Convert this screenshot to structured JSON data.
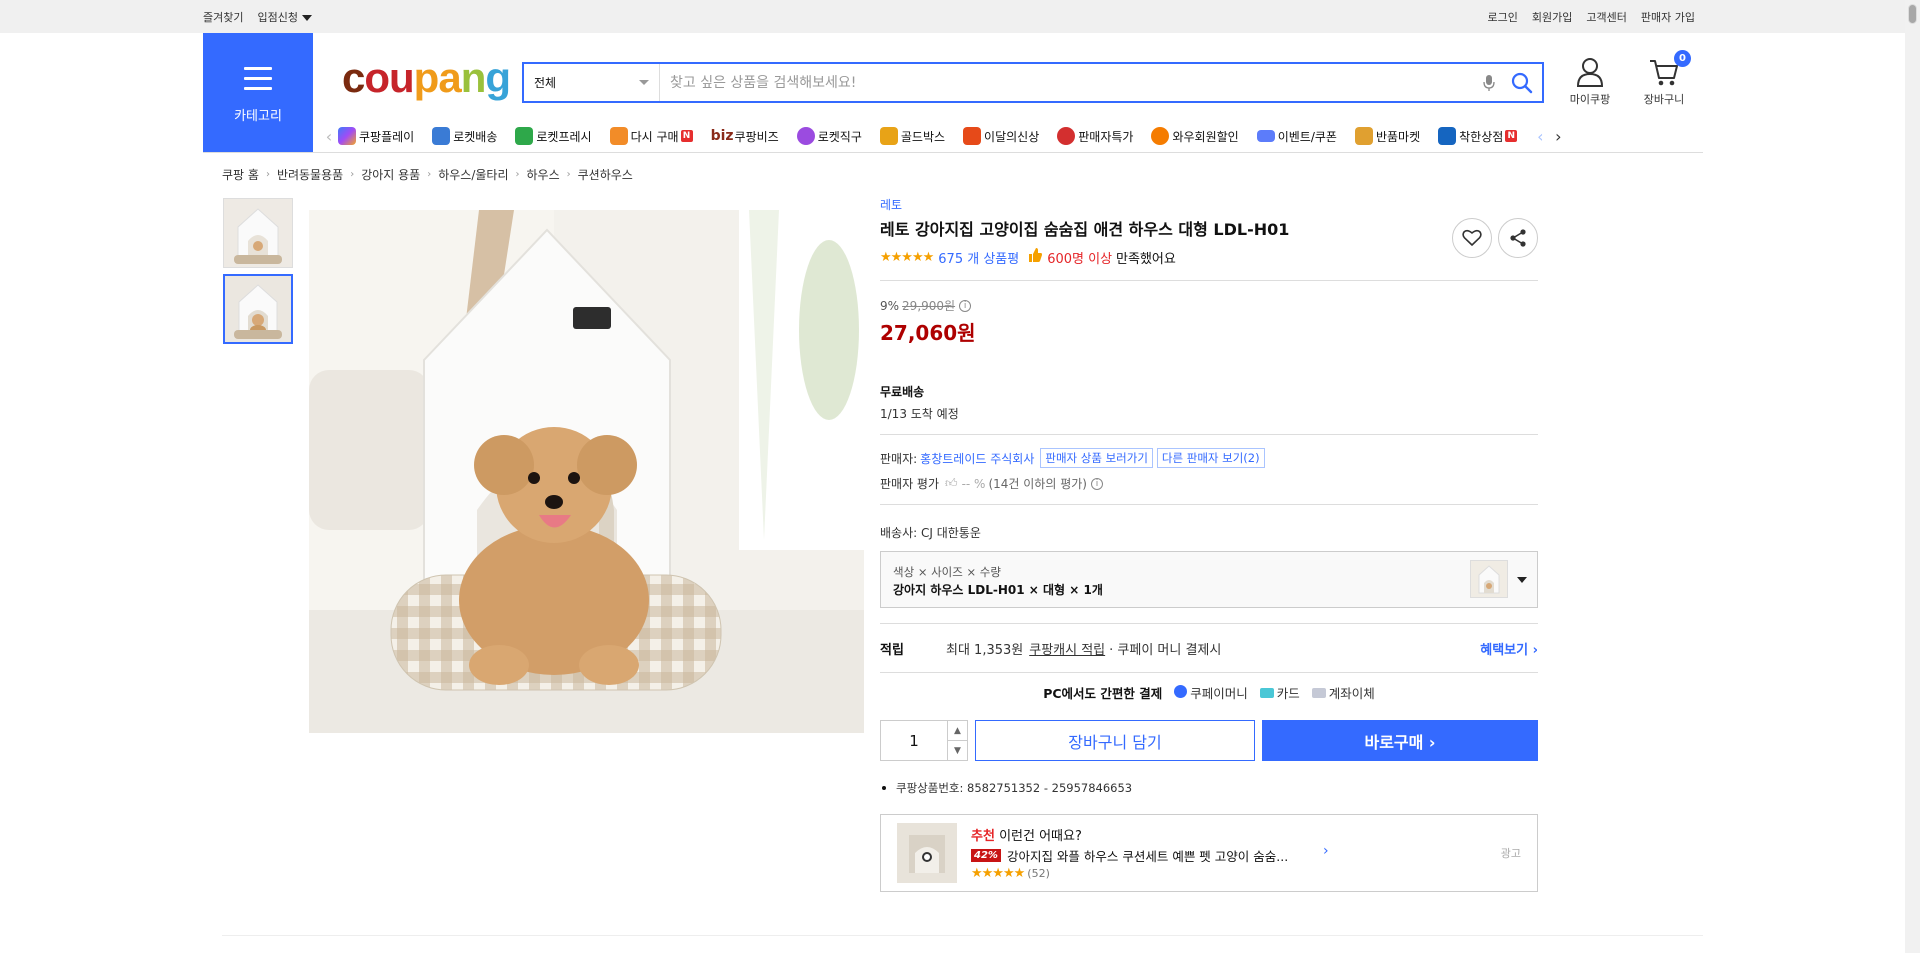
{
  "topbar": {
    "favorites": "즐겨찾기",
    "register": "입점신청",
    "links": [
      "로그인",
      "회원가입",
      "고객센터",
      "판매자 가입"
    ]
  },
  "category": {
    "label": "카테고리"
  },
  "logo": {
    "p1": "c",
    "p2": "ou",
    "p3": "pa",
    "p4": "n",
    "p5": "g"
  },
  "search": {
    "category": "전체",
    "placeholder": "찾고 싶은 상품을 검색해보세요!"
  },
  "account": {
    "my": "마이쿠팡",
    "cart": "장바구니",
    "cart_count": "0"
  },
  "nav": {
    "items": [
      {
        "label": "쿠팡플레이",
        "icon": "coupang-play-icon",
        "color": "#6b4ff0"
      },
      {
        "label": "로켓배송",
        "icon": "rocket-icon",
        "color": "#3a7bd5"
      },
      {
        "label": "로켓프레시",
        "icon": "rocket-fresh-icon",
        "color": "#2ea84a"
      },
      {
        "label": "다시 구매",
        "icon": "rebuy-icon",
        "color": "#f28c28",
        "badge": "N"
      },
      {
        "label": "쿠팡비즈",
        "icon": "biz-icon",
        "color": "#8a2b1a"
      },
      {
        "label": "로켓직구",
        "icon": "rocket-global-icon",
        "color": "#9b4be0"
      },
      {
        "label": "골드박스",
        "icon": "goldbox-icon",
        "color": "#e8a317"
      },
      {
        "label": "이달의신상",
        "icon": "new-icon",
        "color": "#e64a19"
      },
      {
        "label": "판매자특가",
        "icon": "seller-deal-icon",
        "color": "#d32f2f"
      },
      {
        "label": "와우회원할인",
        "icon": "wow-icon",
        "color": "#f57c00"
      },
      {
        "label": "이벤트/쿠폰",
        "icon": "coupon-icon",
        "color": "#5c7cfa"
      },
      {
        "label": "반품마켓",
        "icon": "return-market-icon",
        "color": "#e0a030"
      },
      {
        "label": "착한상점",
        "icon": "good-store-icon",
        "color": "#1565c0",
        "badge": "N"
      }
    ],
    "biz_prefix": "biz"
  },
  "breadcrumb": [
    "쿠팡 홈",
    "반려동물용품",
    "강아지 용품",
    "하우스/울타리",
    "하우스",
    "쿠션하우스"
  ],
  "product": {
    "brand": "레토",
    "title": "레토 강아지집 고양이집 숨숨집 애견 하우스 대형 LDL-H01",
    "stars": "★★★★★",
    "review_count": "675 개 상품평",
    "satisfied_count": "600명 이상",
    "satisfied_suffix": "만족했어요",
    "discount": "9%",
    "original_price": "29,900원",
    "price": "27,060원",
    "shipping_title": "무료배송",
    "arrival": "1/13 도착 예정",
    "seller_label": "판매자:",
    "seller_name": "홍창트레이드 주식회사",
    "seller_products": "판매자 상품 보러가기",
    "other_sellers": "다른 판매자 보기(2)",
    "seller_rating_label": "판매자 평가",
    "seller_rating_value": "-- %",
    "seller_rating_note": "(14건 이하의 평가)",
    "carrier": "배송사:  CJ 대한통운",
    "option_keys": "색상 × 사이즈 × 수량",
    "option_value": "강아지 하우스 LDL-H01 × 대형 × 1개",
    "reward_label": "적립",
    "reward_text": "최대 1,353원",
    "reward_link": "쿠팡캐시 적립",
    "reward_suffix": "· 쿠페이 머니 결제시",
    "reward_more": "혜택보기 ›",
    "pay_title": "PC에서도 간편한 결제",
    "pay_methods": [
      "쿠페이머니",
      "카드",
      "계좌이체"
    ],
    "quantity": "1",
    "cart_button": "장바구니 담기",
    "buy_button": "바로구매 ›",
    "product_id": "쿠팡상품번호: 8582751352 - 25957846653"
  },
  "recommend": {
    "label_red": "추천",
    "label": "이런건 어때요?",
    "discount": "42%",
    "title": "강아지집 와플 하우스 쿠션세트 예쁜 펫 고양이 숨숨...",
    "stars": "★★★★★",
    "reviews": "(52)",
    "ad": "광고"
  }
}
